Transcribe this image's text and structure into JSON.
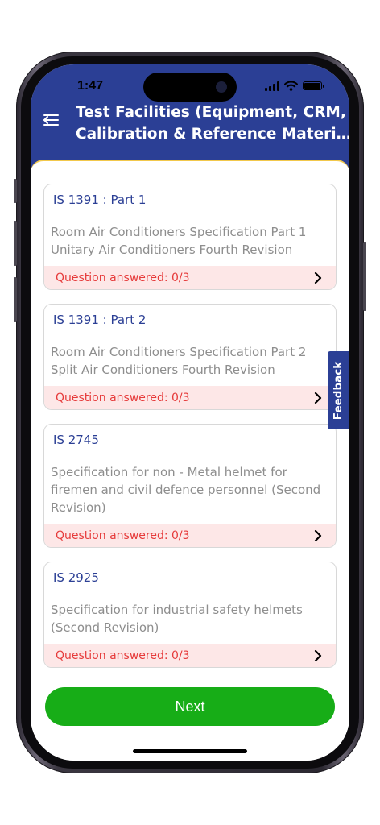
{
  "status_bar": {
    "time": "1:47"
  },
  "header": {
    "title_line1": "Test Facilities (Equipment, CRM,",
    "title_line2": "Calibration & Reference Materia..."
  },
  "standards": [
    {
      "code": "IS 1391 : Part 1",
      "desc_line1": "Room Air Conditioners Specification Part 1",
      "desc_line2": "Unitary Air Conditioners Fourth Revision",
      "desc_line3": "",
      "progress": "Question answered: 0/3"
    },
    {
      "code": "IS 1391 : Part 2",
      "desc_line1": "Room Air Conditioners  Specification Part 2",
      "desc_line2": "Split Air Conditioners Fourth Revision",
      "desc_line3": "",
      "progress": "Question answered: 0/3"
    },
    {
      "code": "IS 2745",
      "desc_line1": "Specification for non - Metal helmet for",
      "desc_line2": "firemen and civil defence personnel (Second",
      "desc_line3": "Revision)",
      "progress": "Question answered: 0/3"
    },
    {
      "code": "IS 2925",
      "desc_line1": "Specification for industrial safety helmets",
      "desc_line2": "(Second Revision)",
      "desc_line3": "",
      "progress": "Question answered: 0/3"
    }
  ],
  "feedback_label": "Feedback",
  "next_label": "Next",
  "colors": {
    "header": "#2b3f95",
    "accent_green": "#17ad17",
    "progress_text": "#e63b3b",
    "progress_bg": "#fde7e7"
  },
  "icons": {
    "menu": "back-menu-icon",
    "chevron": "chevron-right-icon",
    "signal": "signal-icon",
    "wifi": "wifi-icon",
    "battery": "battery-icon"
  }
}
